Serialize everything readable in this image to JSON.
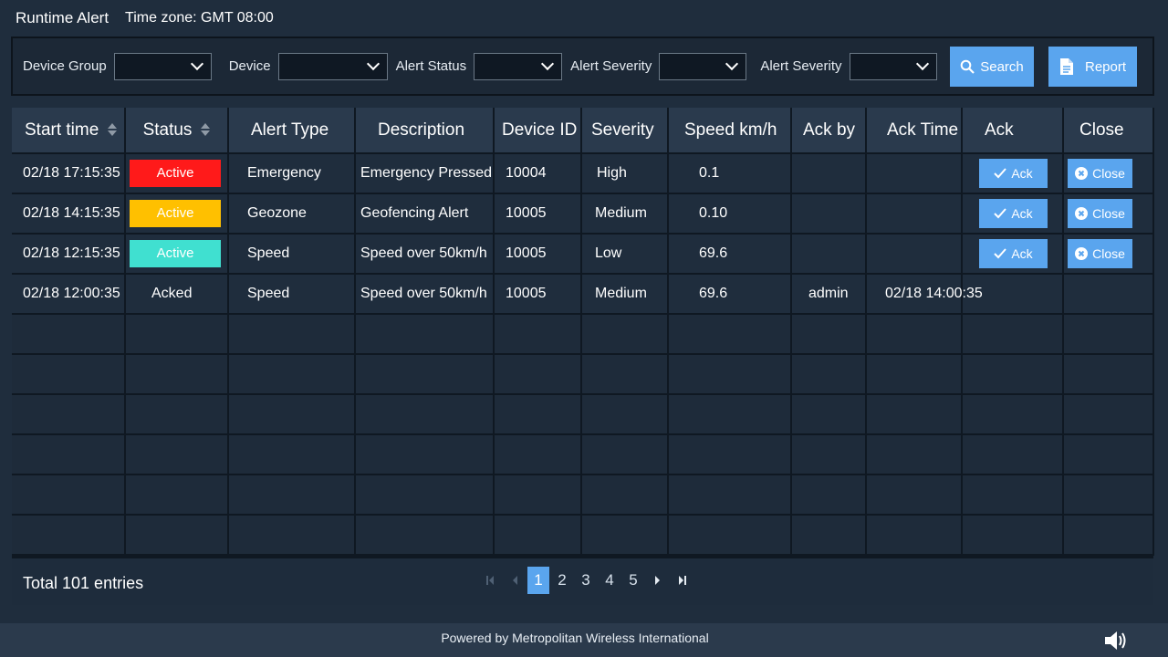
{
  "header": {
    "title": "Runtime Alert",
    "timezone": "Time zone: GMT  08:00"
  },
  "filters": {
    "device_group_label": "Device Group",
    "device_label": "Device",
    "alert_status_label": "Alert Status",
    "alert_severity_label": "Alert Severity",
    "alert_severity2_label": "Alert Severity",
    "search_label": "Search",
    "report_label": "Report"
  },
  "table": {
    "columns": [
      "Start time",
      "Status",
      "Alert Type",
      "Description",
      "Device ID",
      "Severity",
      "Speed km/h",
      "Ack by",
      "Ack Time",
      "Ack",
      "Close"
    ],
    "rows": [
      {
        "start": "02/18 17:15:35",
        "status": "Active",
        "status_color": "#ff1a1a",
        "type": "Emergency",
        "desc": "Emergency Pressed",
        "device": "10004",
        "severity": "High",
        "speed": "0.1",
        "ack_by": "",
        "ack_time": "",
        "ack": "Ack",
        "close": "Close"
      },
      {
        "start": "02/18 14:15:35",
        "status": "Active",
        "status_color": "#ffc000",
        "type": "Geozone",
        "desc": "Geofencing  Alert",
        "device": "10005",
        "severity": "Medium",
        "speed": "0.10",
        "ack_by": "",
        "ack_time": "",
        "ack": "Ack",
        "close": "Close"
      },
      {
        "start": "02/18 12:15:35",
        "status": "Active",
        "status_color": "#40e0d0",
        "type": "Speed",
        "desc": "Speed over 50km/h",
        "device": "10005",
        "severity": "Low",
        "speed": "69.6",
        "ack_by": "",
        "ack_time": "",
        "ack": "Ack",
        "close": "Close"
      },
      {
        "start": "02/18 12:00:35",
        "status": "Acked",
        "status_color": "",
        "type": "Speed",
        "desc": "Speed over 50km/h",
        "device": "10005",
        "severity": "Medium",
        "speed": "69.6",
        "ack_by": "admin",
        "ack_time": "02/18 14:00:35",
        "ack": "",
        "close": ""
      }
    ]
  },
  "footer": {
    "total": "Total 101 entries",
    "pages": [
      "1",
      "2",
      "3",
      "4",
      "5"
    ],
    "current_page": "1",
    "powered": "Powered by Metropolitan Wireless International"
  },
  "colors": {
    "accent": "#5aa5ee",
    "background": "#1f2d3d"
  },
  "icons": [
    "search-icon",
    "report-icon",
    "check-icon",
    "close-circle-icon",
    "speaker-icon",
    "chevron-down-icon"
  ]
}
